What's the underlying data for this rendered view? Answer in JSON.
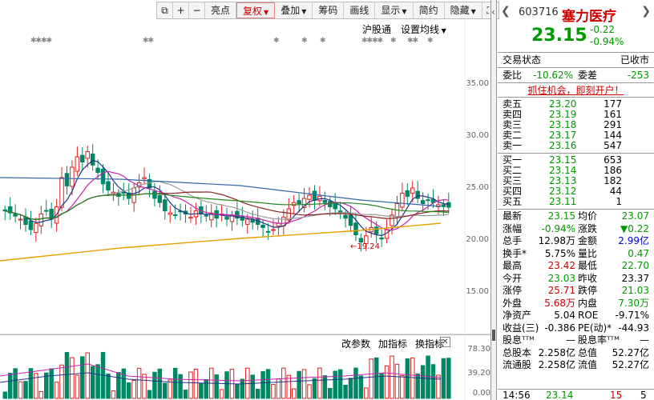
{
  "toolbar": {
    "items": [
      {
        "label": "",
        "icon": "layout-icon"
      },
      {
        "label": "+",
        "icon": "zoom-in-icon"
      },
      {
        "label": "−",
        "icon": "zoom-out-icon"
      },
      {
        "label": "亮点"
      },
      {
        "label": "复权",
        "active": true
      },
      {
        "label": "叠加"
      },
      {
        "label": "筹码"
      },
      {
        "label": "画线"
      },
      {
        "label": "显示"
      },
      {
        "label": "简约"
      },
      {
        "label": "隐藏"
      },
      {
        "label": "",
        "icon": "fullscreen-icon"
      }
    ]
  },
  "chart_links": {
    "hk_connect": "沪股通",
    "set_ma": "设置均线"
  },
  "price_axis": [
    "35.00",
    "30.00",
    "25.00",
    "20.00",
    "15.00"
  ],
  "low_marker": "19.24",
  "vol_links": {
    "params": "改参数",
    "add": "加指标",
    "change": "换指标"
  },
  "vol_axis": [
    "78.30",
    "39.20",
    "0.00"
  ],
  "stock": {
    "code": "603716",
    "name": "塞力医疗",
    "price": "23.15",
    "change": "-0.22",
    "change_pct": "-0.94%"
  },
  "status": {
    "label": "交易状态",
    "value": "已收市"
  },
  "ratio": {
    "l1": "委比",
    "v1": "-10.62%",
    "l2": "委差",
    "v2": "-253"
  },
  "promo": "抓住机会，即刻开户！",
  "sell": [
    {
      "label": "卖五",
      "price": "23.20",
      "vol": "177"
    },
    {
      "label": "卖四",
      "price": "23.19",
      "vol": "161"
    },
    {
      "label": "卖三",
      "price": "23.18",
      "vol": "291"
    },
    {
      "label": "卖二",
      "price": "23.17",
      "vol": "144"
    },
    {
      "label": "卖一",
      "price": "23.16",
      "vol": "547"
    }
  ],
  "buy": [
    {
      "label": "买一",
      "price": "23.15",
      "vol": "653"
    },
    {
      "label": "买二",
      "price": "23.14",
      "vol": "186"
    },
    {
      "label": "买三",
      "price": "23.13",
      "vol": "182"
    },
    {
      "label": "买四",
      "price": "23.12",
      "vol": "44"
    },
    {
      "label": "买五",
      "price": "23.11",
      "vol": "1"
    }
  ],
  "stats": [
    {
      "l1": "最新",
      "v1": "23.15",
      "c1": "green",
      "l2": "均价",
      "v2": "23.07",
      "c2": "green"
    },
    {
      "l1": "涨幅",
      "v1": "-0.94%",
      "c1": "green",
      "l2": "涨跌",
      "v2": "▼0.22",
      "c2": "green"
    },
    {
      "l1": "总手",
      "v1": "12.98万",
      "c1": "",
      "l2": "金额",
      "v2": "2.99亿",
      "c2": "blue"
    },
    {
      "l1": "换手*",
      "v1": "5.75%",
      "c1": "",
      "l2": "量比",
      "v2": "0.47",
      "c2": "green"
    },
    {
      "l1": "最高",
      "v1": "23.42",
      "c1": "red",
      "l2": "最低",
      "v2": "22.70",
      "c2": "green"
    },
    {
      "l1": "今开",
      "v1": "23.03",
      "c1": "green",
      "l2": "昨收",
      "v2": "23.37",
      "c2": ""
    },
    {
      "l1": "涨停",
      "v1": "25.71",
      "c1": "red",
      "l2": "跌停",
      "v2": "21.03",
      "c2": "green"
    },
    {
      "l1": "外盘",
      "v1": "5.68万",
      "c1": "red",
      "l2": "内盘",
      "v2": "7.30万",
      "c2": "green"
    },
    {
      "l1": "净资产",
      "v1": "5.04",
      "c1": "",
      "l2": "ROE",
      "v2": "-9.71%",
      "c2": ""
    },
    {
      "l1": "收益(三)",
      "v1": "-0.386",
      "c1": "",
      "l2": "PE(动)*",
      "v2": "-44.93",
      "c2": ""
    },
    {
      "l1": "股息ᵀᵀᴹ",
      "v1": "—",
      "c1": "",
      "l2": "股息率ᵀᵀᴹ",
      "v2": "—",
      "c2": ""
    },
    {
      "l1": "总股本",
      "v1": "2.258亿",
      "c1": "",
      "l2": "总值",
      "v2": "52.27亿",
      "c2": ""
    },
    {
      "l1": "流通股",
      "v1": "2.258亿",
      "c1": "",
      "l2": "流值",
      "v2": "52.27亿",
      "c2": ""
    }
  ],
  "tick": {
    "time": "14:56",
    "price": "23.14",
    "vol": "15",
    "num": "5"
  }
}
